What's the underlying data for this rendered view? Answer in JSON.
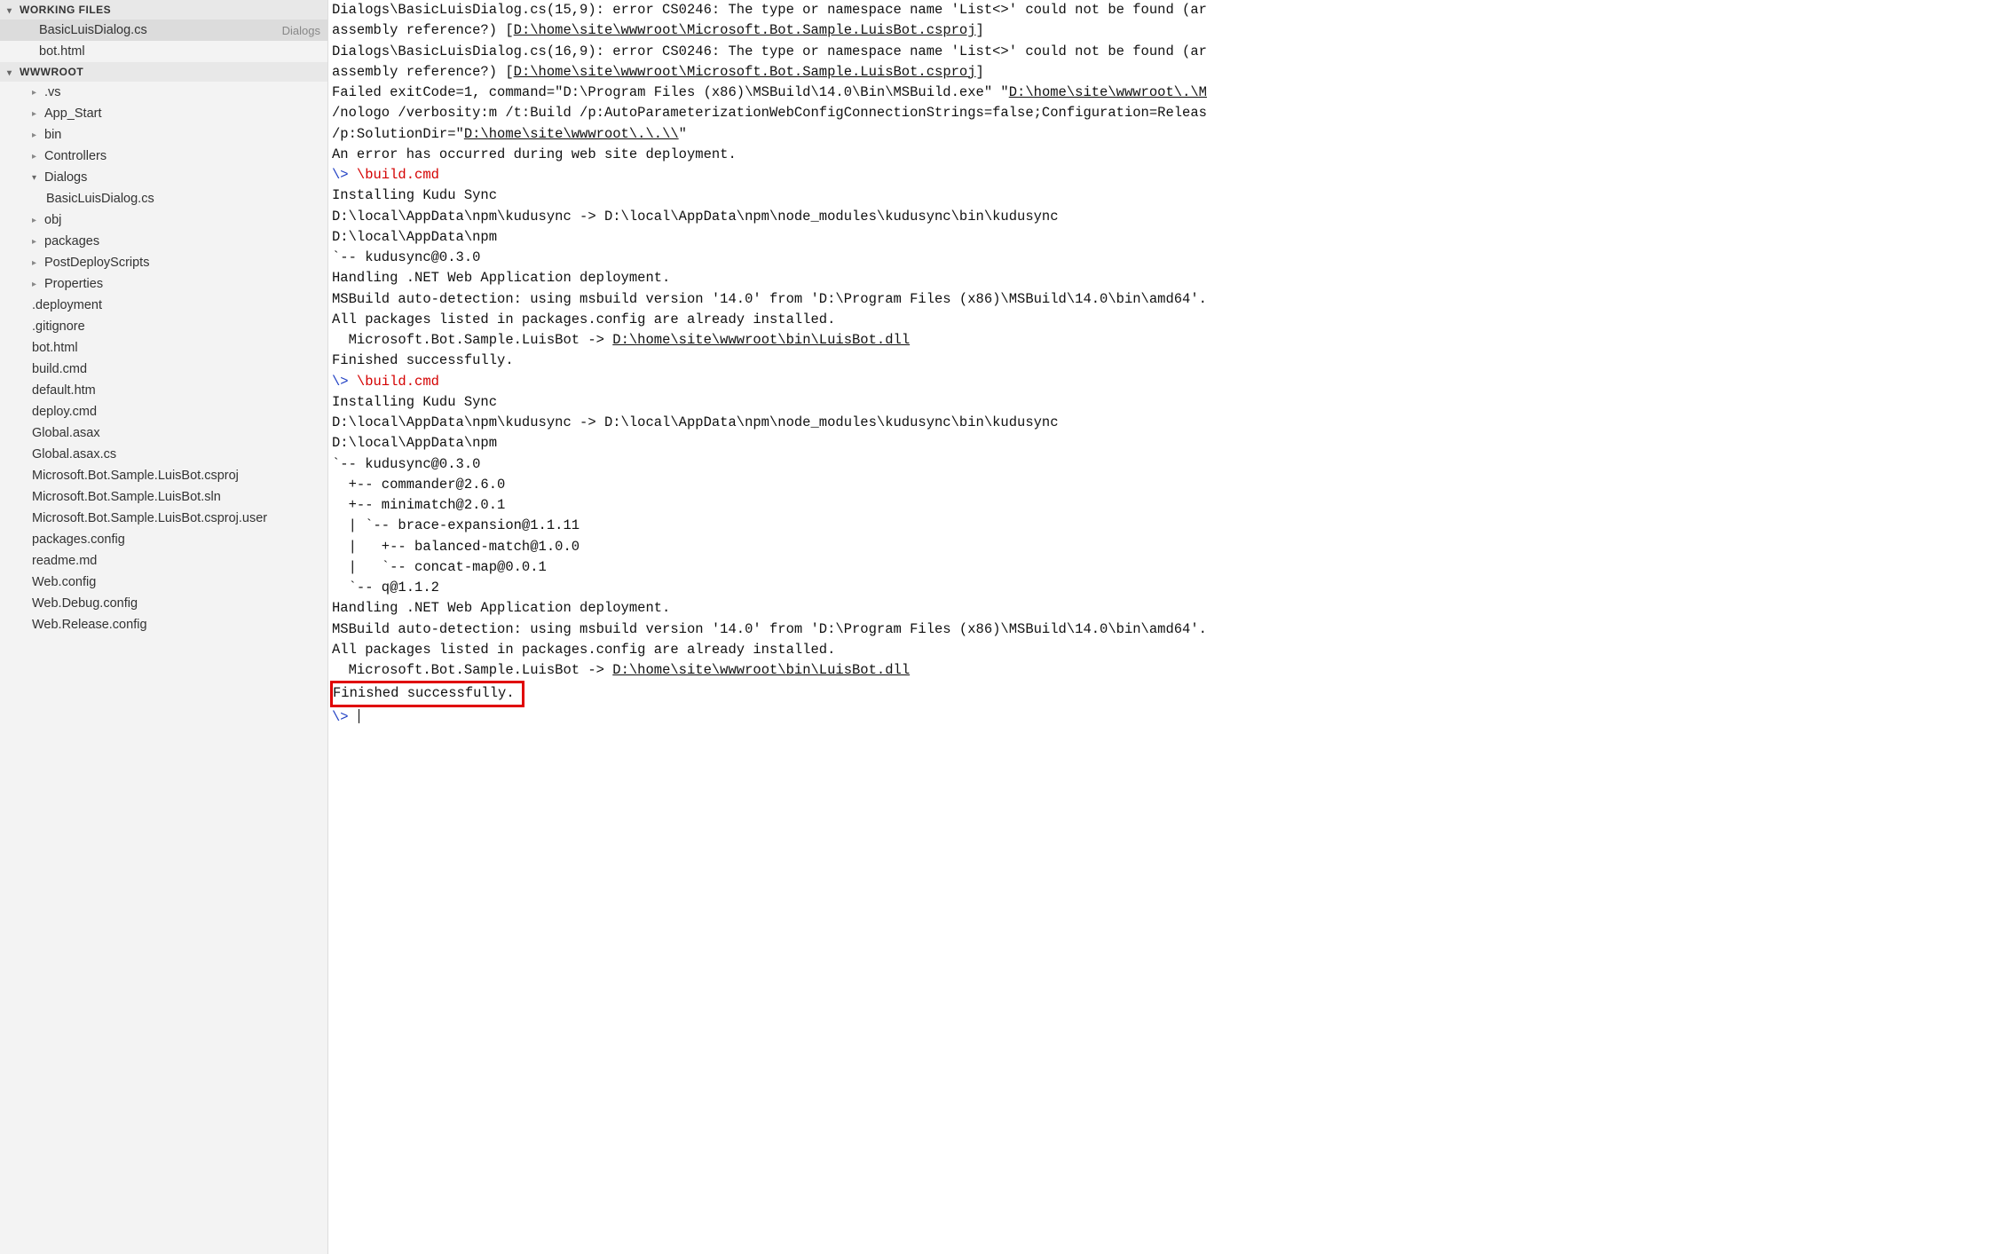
{
  "sidebar": {
    "sections": {
      "working_files": {
        "title": "WORKING FILES",
        "items": [
          {
            "name": "BasicLuisDialog.cs",
            "dir": "Dialogs",
            "active": true
          },
          {
            "name": "bot.html",
            "dir": "",
            "active": false
          }
        ]
      },
      "wwwroot": {
        "title": "WWWROOT",
        "folders": [
          {
            "name": ".vs",
            "expanded": false,
            "level": 1
          },
          {
            "name": "App_Start",
            "expanded": false,
            "level": 1
          },
          {
            "name": "bin",
            "expanded": false,
            "level": 1
          },
          {
            "name": "Controllers",
            "expanded": false,
            "level": 1
          },
          {
            "name": "Dialogs",
            "expanded": true,
            "level": 1,
            "children": [
              {
                "name": "BasicLuisDialog.cs",
                "level": 2
              }
            ]
          },
          {
            "name": "obj",
            "expanded": false,
            "level": 1
          },
          {
            "name": "packages",
            "expanded": false,
            "level": 1
          },
          {
            "name": "PostDeployScripts",
            "expanded": false,
            "level": 1
          },
          {
            "name": "Properties",
            "expanded": false,
            "level": 1
          }
        ],
        "files": [
          ".deployment",
          ".gitignore",
          "bot.html",
          "build.cmd",
          "default.htm",
          "deploy.cmd",
          "Global.asax",
          "Global.asax.cs",
          "Microsoft.Bot.Sample.LuisBot.csproj",
          "Microsoft.Bot.Sample.LuisBot.sln",
          "Microsoft.Bot.Sample.LuisBot.csproj.user",
          "packages.config",
          "readme.md",
          "Web.config",
          "Web.Debug.config",
          "Web.Release.config"
        ]
      }
    }
  },
  "console": {
    "blocks": [
      {
        "type": "plain",
        "text": "Dialogs\\BasicLuisDialog.cs(15,9): error CS0246: The type or namespace name 'List<>' could not be found (ar"
      },
      {
        "type": "mixed",
        "parts": [
          {
            "t": "plain",
            "v": "assembly reference?) ["
          },
          {
            "t": "u",
            "v": "D:\\home\\site\\wwwroot\\Microsoft.Bot.Sample.LuisBot.csproj"
          },
          {
            "t": "plain",
            "v": "]"
          }
        ]
      },
      {
        "type": "plain",
        "text": "Dialogs\\BasicLuisDialog.cs(16,9): error CS0246: The type or namespace name 'List<>' could not be found (ar"
      },
      {
        "type": "mixed",
        "parts": [
          {
            "t": "plain",
            "v": "assembly reference?) ["
          },
          {
            "t": "u",
            "v": "D:\\home\\site\\wwwroot\\Microsoft.Bot.Sample.LuisBot.csproj"
          },
          {
            "t": "plain",
            "v": "]"
          }
        ]
      },
      {
        "type": "mixed",
        "parts": [
          {
            "t": "plain",
            "v": "Failed exitCode=1, command=\"D:\\Program Files (x86)\\MSBuild\\14.0\\Bin\\MSBuild.exe\" \""
          },
          {
            "t": "u",
            "v": "D:\\home\\site\\wwwroot\\.\\M"
          }
        ]
      },
      {
        "type": "plain",
        "text": "/nologo /verbosity:m /t:Build /p:AutoParameterizationWebConfigConnectionStrings=false;Configuration=Releas"
      },
      {
        "type": "mixed",
        "parts": [
          {
            "t": "plain",
            "v": "/p:SolutionDir=\""
          },
          {
            "t": "u",
            "v": "D:\\home\\site\\wwwroot\\.\\.\\\\"
          },
          {
            "t": "plain",
            "v": "\""
          }
        ]
      },
      {
        "type": "plain",
        "text": "An error has occurred during web site deployment."
      },
      {
        "type": "prompt",
        "prompt": "\\> ",
        "cmd": "\\build.cmd"
      },
      {
        "type": "plain",
        "text": "Installing Kudu Sync"
      },
      {
        "type": "plain",
        "text": "D:\\local\\AppData\\npm\\kudusync -> D:\\local\\AppData\\npm\\node_modules\\kudusync\\bin\\kudusync"
      },
      {
        "type": "plain",
        "text": "D:\\local\\AppData\\npm"
      },
      {
        "type": "plain",
        "text": "`-- kudusync@0.3.0"
      },
      {
        "type": "plain",
        "text": ""
      },
      {
        "type": "plain",
        "text": "Handling .NET Web Application deployment."
      },
      {
        "type": "plain",
        "text": "MSBuild auto-detection: using msbuild version '14.0' from 'D:\\Program Files (x86)\\MSBuild\\14.0\\bin\\amd64'."
      },
      {
        "type": "plain",
        "text": "All packages listed in packages.config are already installed."
      },
      {
        "type": "mixed",
        "parts": [
          {
            "t": "plain",
            "v": "  Microsoft.Bot.Sample.LuisBot -> "
          },
          {
            "t": "u",
            "v": "D:\\home\\site\\wwwroot\\bin\\LuisBot.dll"
          }
        ]
      },
      {
        "type": "plain",
        "text": "Finished successfully."
      },
      {
        "type": "prompt",
        "prompt": "\\> ",
        "cmd": "\\build.cmd"
      },
      {
        "type": "plain",
        "text": "Installing Kudu Sync"
      },
      {
        "type": "plain",
        "text": "D:\\local\\AppData\\npm\\kudusync -> D:\\local\\AppData\\npm\\node_modules\\kudusync\\bin\\kudusync"
      },
      {
        "type": "plain",
        "text": "D:\\local\\AppData\\npm"
      },
      {
        "type": "plain",
        "text": "`-- kudusync@0.3.0"
      },
      {
        "type": "plain",
        "text": "  +-- commander@2.6.0"
      },
      {
        "type": "plain",
        "text": "  +-- minimatch@2.0.1"
      },
      {
        "type": "plain",
        "text": "  | `-- brace-expansion@1.1.11"
      },
      {
        "type": "plain",
        "text": "  |   +-- balanced-match@1.0.0"
      },
      {
        "type": "plain",
        "text": "  |   `-- concat-map@0.0.1"
      },
      {
        "type": "plain",
        "text": "  `-- q@1.1.2"
      },
      {
        "type": "plain",
        "text": ""
      },
      {
        "type": "plain",
        "text": "Handling .NET Web Application deployment."
      },
      {
        "type": "plain",
        "text": "MSBuild auto-detection: using msbuild version '14.0' from 'D:\\Program Files (x86)\\MSBuild\\14.0\\bin\\amd64'."
      },
      {
        "type": "plain",
        "text": "All packages listed in packages.config are already installed."
      },
      {
        "type": "mixed",
        "parts": [
          {
            "t": "plain",
            "v": "  Microsoft.Bot.Sample.LuisBot -> "
          },
          {
            "t": "u",
            "v": "D:\\home\\site\\wwwroot\\bin\\LuisBot.dll"
          }
        ]
      },
      {
        "type": "boxed",
        "text": "Finished successfully."
      },
      {
        "type": "prompt-cursor",
        "prompt": "\\> "
      }
    ]
  }
}
